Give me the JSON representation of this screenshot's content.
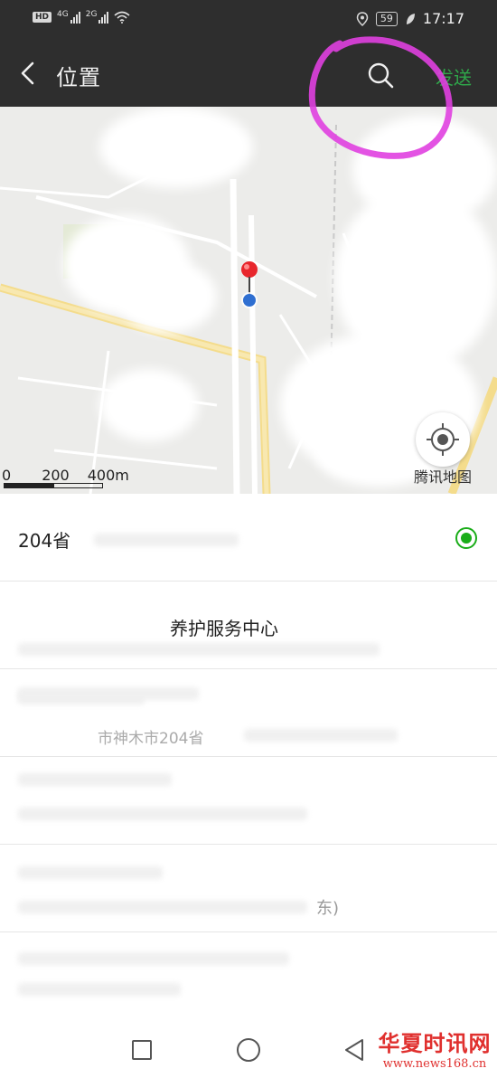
{
  "status_bar": {
    "hd_badge": "HD",
    "network_1": "4G",
    "network_2": "2G",
    "battery": "59",
    "time": "17:17"
  },
  "nav": {
    "title": "位置",
    "send_label": "发送"
  },
  "map": {
    "scale_labels": [
      "0",
      "200",
      "400m"
    ],
    "brand": "腾讯地图"
  },
  "locations": [
    {
      "title": "204省",
      "subtitle": "",
      "selected": true
    },
    {
      "title": "养护服务中心",
      "subtitle": "",
      "selected": false
    },
    {
      "title": "",
      "subtitle": "市神木市204省",
      "selected": false
    },
    {
      "title": "",
      "subtitle": "",
      "selected": false
    },
    {
      "title": "",
      "subtitle": "东)",
      "selected": false
    },
    {
      "title": "",
      "subtitle": "",
      "selected": false
    }
  ],
  "watermark": {
    "title": "华夏时讯网",
    "url": "www.news168.cn"
  },
  "colors": {
    "header_bg": "#2e2e2e",
    "accent_green": "#1aad19",
    "send_green": "#2fa84a",
    "highlight_magenta": "#e040e0",
    "watermark_red": "#e0302e"
  }
}
